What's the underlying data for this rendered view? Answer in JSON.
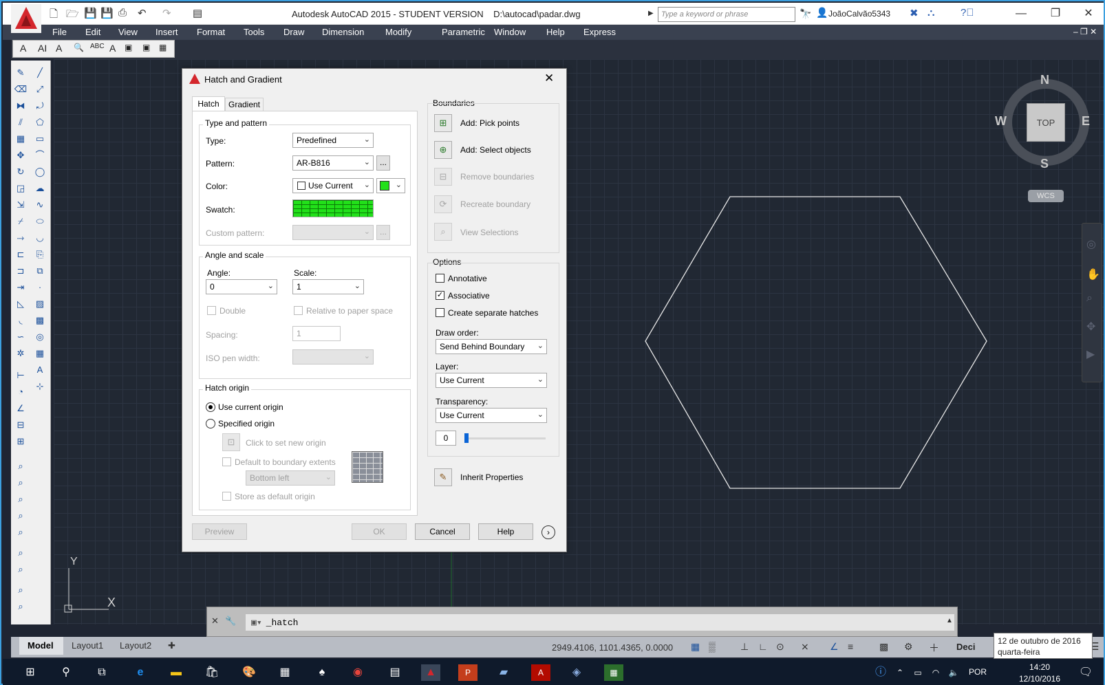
{
  "app": {
    "title": "Autodesk AutoCAD 2015 - STUDENT VERSION    D:\\autocad\\padar.dwg",
    "search_placeholder": "Type a keyword or phrase",
    "user": "JoãoCalvão5343",
    "brand_color": "#d4262c"
  },
  "menu": [
    "File",
    "Edit",
    "View",
    "Insert",
    "Format",
    "Tools",
    "Draw",
    "Dimension",
    "Modify",
    "Parametric",
    "Window",
    "Help",
    "Express"
  ],
  "dialog": {
    "title": "Hatch and Gradient",
    "tabs": [
      "Hatch",
      "Gradient"
    ],
    "type_pattern": {
      "title": "Type and pattern",
      "type_label": "Type:",
      "type_value": "Predefined",
      "pattern_label": "Pattern:",
      "pattern_value": "AR-B816",
      "color_label": "Color:",
      "color_value": "Use Current",
      "swatch_label": "Swatch:",
      "custom_label": "Custom pattern:",
      "swatch_color": "#22e01a"
    },
    "angle_scale": {
      "title": "Angle and scale",
      "angle_label": "Angle:",
      "angle_value": "0",
      "scale_label": "Scale:",
      "scale_value": "1",
      "double_label": "Double",
      "relative_label": "Relative to paper space",
      "spacing_label": "Spacing:",
      "spacing_value": "1",
      "iso_label": "ISO pen width:"
    },
    "origin": {
      "title": "Hatch origin",
      "use_current": "Use current origin",
      "specified": "Specified origin",
      "click_new": "Click to set new origin",
      "default_extents": "Default to boundary extents",
      "position_value": "Bottom left",
      "store_default": "Store as default origin"
    },
    "boundaries": {
      "title": "Boundaries",
      "add_pick": "Add: Pick points",
      "add_select": "Add: Select objects",
      "remove": "Remove boundaries",
      "recreate": "Recreate boundary",
      "view": "View Selections"
    },
    "options": {
      "title": "Options",
      "annotative": "Annotative",
      "associative": "Associative",
      "separate": "Create separate hatches",
      "draw_order_label": "Draw order:",
      "draw_order_value": "Send Behind Boundary",
      "layer_label": "Layer:",
      "layer_value": "Use Current",
      "transparency_label": "Transparency:",
      "transparency_value": "Use Current",
      "transparency_number": "0"
    },
    "inherit": "Inherit Properties",
    "buttons": {
      "preview": "Preview",
      "ok": "OK",
      "cancel": "Cancel",
      "help": "Help"
    }
  },
  "viewcube": {
    "north": "N",
    "south": "S",
    "east": "E",
    "west": "W",
    "face": "TOP",
    "wcs": "WCS"
  },
  "ucs": {
    "x": "X",
    "y": "Y"
  },
  "command": {
    "text": "_hatch"
  },
  "layout_tabs": [
    "Model",
    "Layout1",
    "Layout2"
  ],
  "status": {
    "coords": "2949.4106, 1101.4365, 0.0000",
    "units": "Deci",
    "tooltip_line1": "12 de outubro de 2016",
    "tooltip_line2": "quarta-feira"
  },
  "taskbar": {
    "lang": "POR",
    "time": "14:20",
    "date": "12/10/2016"
  }
}
